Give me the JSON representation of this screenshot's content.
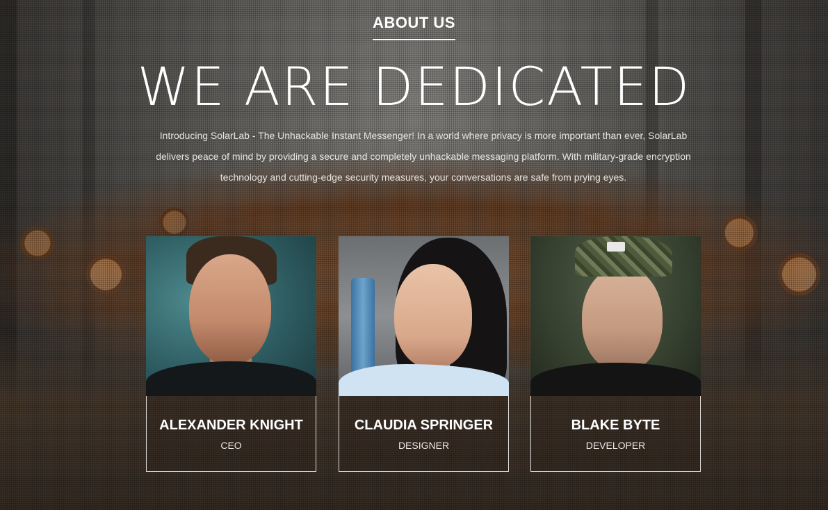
{
  "section": {
    "label": "ABOUT US"
  },
  "hero": {
    "headline": "WE ARE DEDICATED",
    "intro": "Introducing SolarLab - The Unhackable Instant Messenger! In a world where privacy is more important than ever, SolarLab delivers peace of mind by providing a secure and completely unhackable messaging platform. With military-grade encryption technology and cutting-edge security measures, your conversations are safe from prying eyes."
  },
  "team": [
    {
      "name": "ALEXANDER KNIGHT",
      "role": "CEO"
    },
    {
      "name": "CLAUDIA SPRINGER",
      "role": "DESIGNER"
    },
    {
      "name": "BLAKE BYTE",
      "role": "DEVELOPER"
    }
  ],
  "colors": {
    "text": "#ffffff",
    "card_border": "#ffffff"
  }
}
